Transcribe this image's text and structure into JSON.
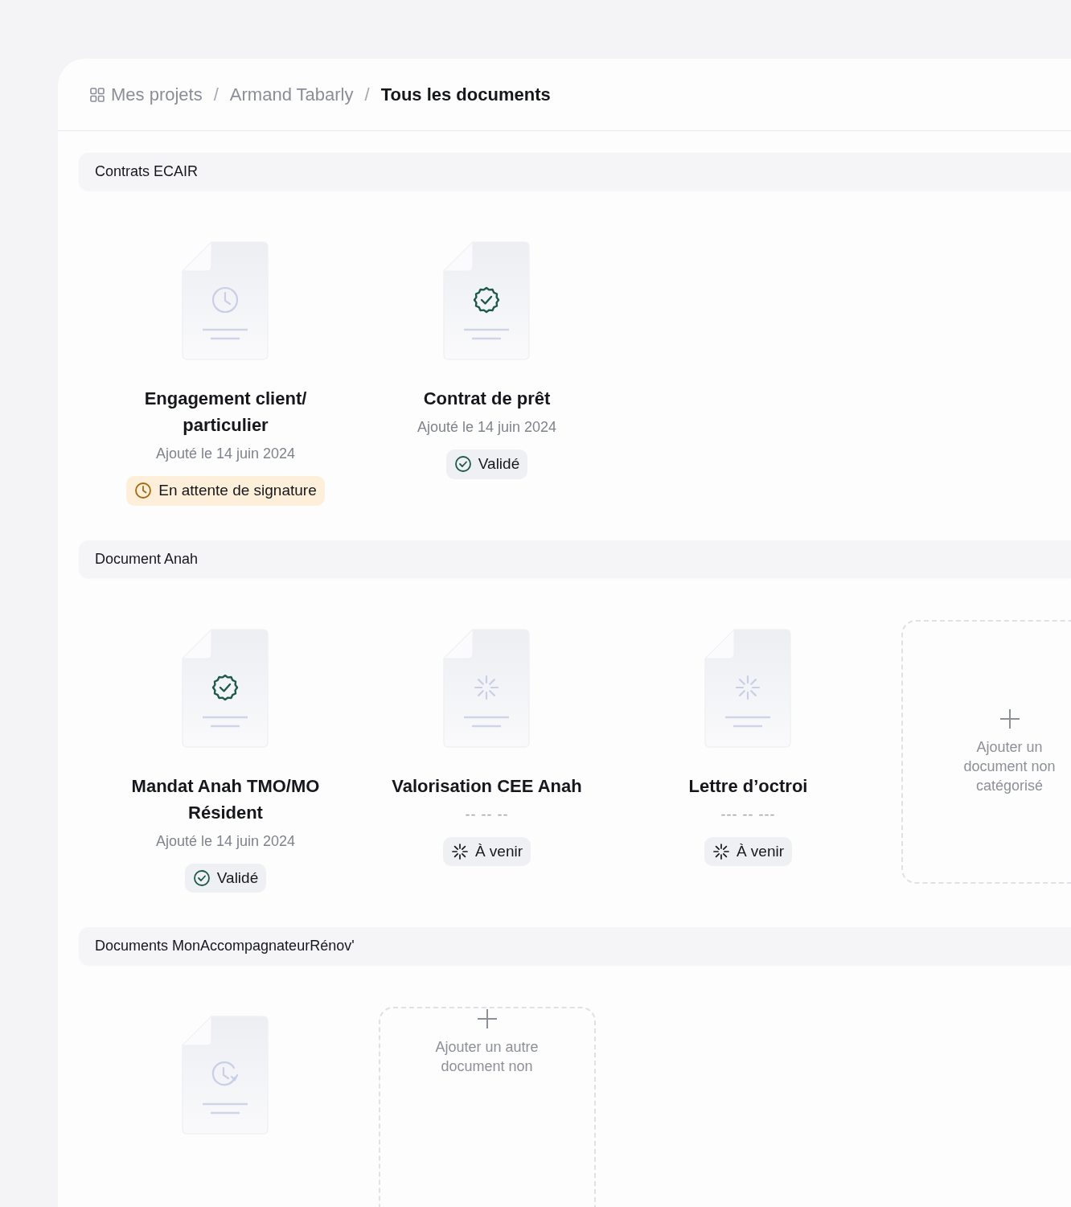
{
  "breadcrumb": [
    {
      "label": "Mes projets",
      "current": false,
      "icon": true
    },
    {
      "separator_before": "/",
      "label": "Armand Tabarly",
      "current": false
    },
    {
      "separator_before": "/",
      "label": "Tous les documents",
      "current": true
    }
  ],
  "sections": [
    {
      "title": "Contrats ECAIR",
      "items": [
        {
          "kind": "pending",
          "title": "Engagement client/\nparticulier",
          "date": "Ajouté le 14 juin 2024",
          "status": "En attente de signature"
        },
        {
          "kind": "validated",
          "title": "Contrat de prêt",
          "date": "Ajouté le 14 juin 2024",
          "status": "Validé"
        }
      ]
    },
    {
      "title": "Document Anah",
      "items": [
        {
          "kind": "validated",
          "title": "Mandat Anah TMO/MO\nRésident",
          "date": "Ajouté le 14 juin 2024",
          "status": "Validé"
        },
        {
          "kind": "upcoming",
          "title": "Valorisation CEE Anah",
          "date": "-- -- --",
          "status": "À venir"
        },
        {
          "kind": "upcoming",
          "title": "Lettre d’octroi",
          "date": "--- -- ---",
          "status": "À venir"
        },
        {
          "kind": "add",
          "label": "Ajouter un\ndocument non\ncatégorisé"
        }
      ]
    },
    {
      "title": "Documents MonAccompagnateurRénov'",
      "items": [
        {
          "kind": "history"
        },
        {
          "kind": "add",
          "label": "Ajouter un autre\ndocument non"
        }
      ]
    }
  ]
}
